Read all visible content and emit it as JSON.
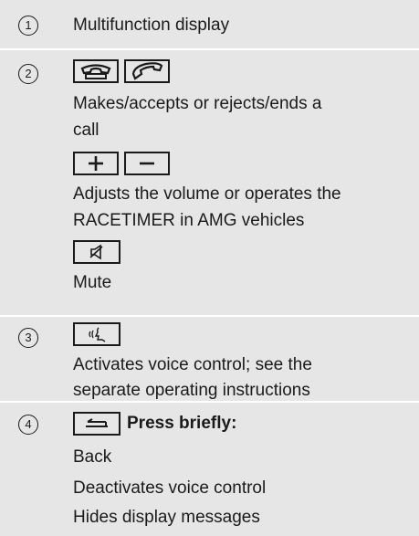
{
  "rows": [
    {
      "number": "1",
      "items": {
        "desc": "Multifunction display"
      }
    },
    {
      "number": "2",
      "phone_keys": [
        "hang-up-phone-icon",
        "accept-call-phone-icon"
      ],
      "phone_desc_line1": "Makes/accepts or rejects/ends a",
      "phone_desc_line2": "call",
      "volume_keys": [
        "plus-icon",
        "minus-icon"
      ],
      "volume_desc_line1": "Adjusts the volume or operates the",
      "volume_desc_line2": "RACETIMER in AMG vehicles",
      "mute_key": "mute-speaker-icon",
      "mute_desc": "Mute"
    },
    {
      "number": "3",
      "voice_key": "voice-control-icon",
      "voice_desc_line1": "Activates voice control; see the",
      "voice_desc_line2": "separate operating instructions"
    },
    {
      "number": "4",
      "back_key": "back-arrow-icon",
      "press_label": "Press briefly:",
      "functions": [
        "Back",
        "Deactivates voice control",
        "Hides display messages"
      ]
    }
  ]
}
